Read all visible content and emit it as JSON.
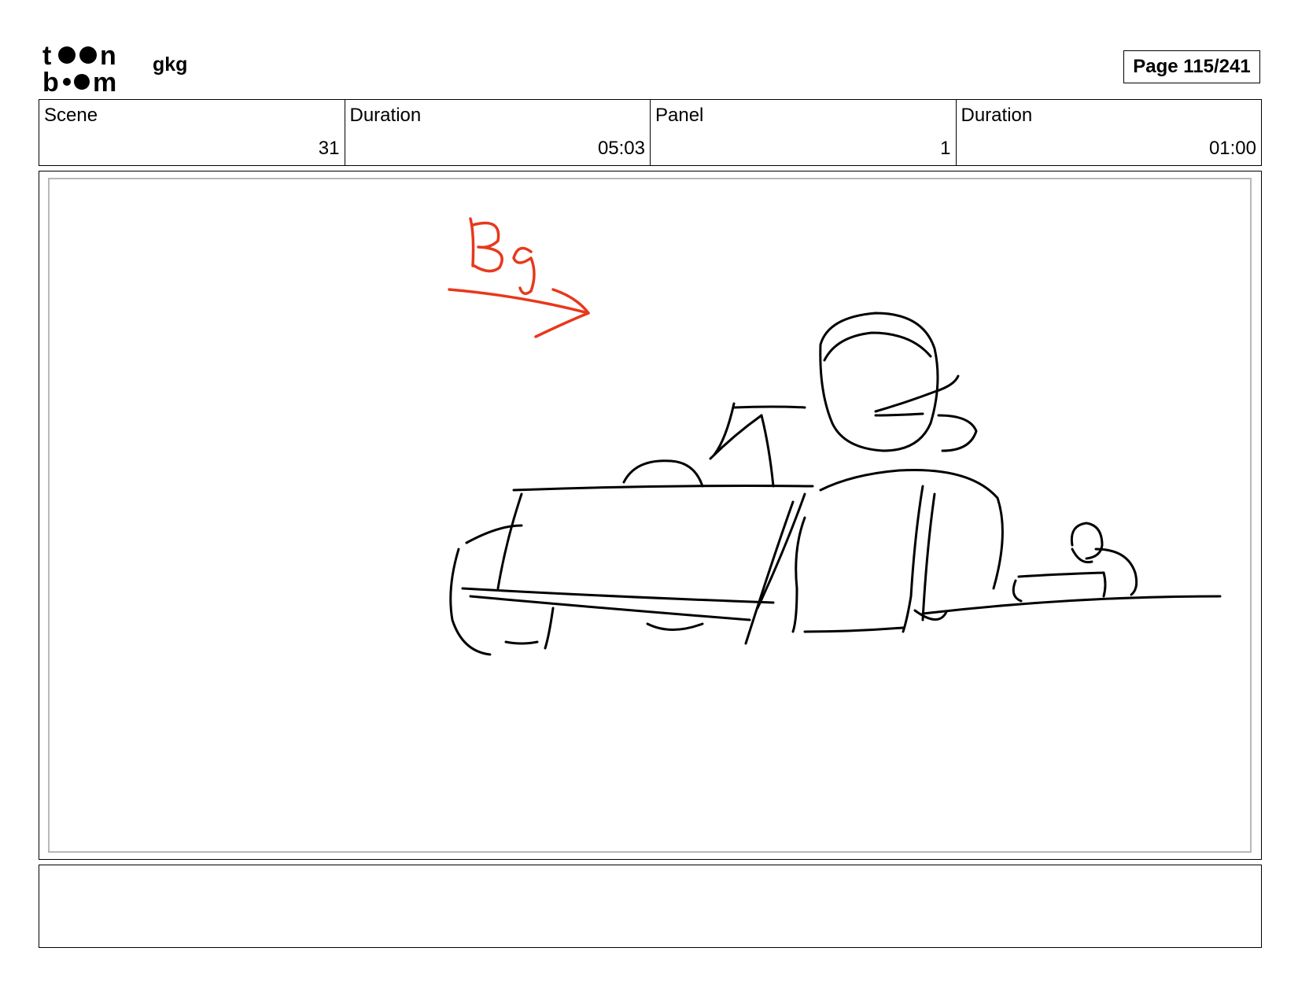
{
  "header": {
    "logo_text": "toon boom",
    "project_name": "gkg",
    "page_label": "Page 115/241"
  },
  "info": [
    {
      "label": "Scene",
      "value": "31"
    },
    {
      "label": "Duration",
      "value": "05:03"
    },
    {
      "label": "Panel",
      "value": "1"
    },
    {
      "label": "Duration",
      "value": "01:00"
    }
  ],
  "panel": {
    "annotation_text": "Bg",
    "annotation_color": "#e8381b",
    "sketch_color": "#000000"
  },
  "notes": {
    "text": ""
  }
}
